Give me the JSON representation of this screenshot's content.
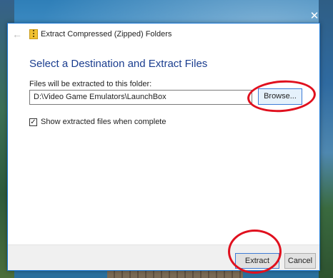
{
  "dialog": {
    "title": "Extract Compressed (Zipped) Folders",
    "close_glyph": "✕",
    "back_glyph": "←",
    "heading": "Select a Destination and Extract Files",
    "destination_label": "Files will be extracted to this folder:",
    "destination_path": "D:\\Video Game Emulators\\LaunchBox",
    "browse_label": "Browse...",
    "show_files_label": "Show extracted files when complete",
    "show_files_checked": true,
    "checkbox_glyph": "✓",
    "extract_label": "Extract",
    "cancel_label": "Cancel"
  },
  "colors": {
    "heading": "#1a3d8f",
    "accent_border": "#3d7bd6",
    "annotation": "#e0101e"
  },
  "icons": {
    "back": "back-arrow-icon",
    "folder": "zip-folder-icon",
    "close": "close-icon"
  }
}
